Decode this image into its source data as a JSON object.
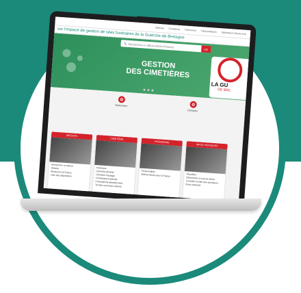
{
  "colors": {
    "teal": "#1b8a7a",
    "red": "#d4232b",
    "green": "#2d8f5c"
  },
  "screen": {
    "nav": [
      "Défunts",
      "Cimetières",
      "Patrimoine",
      "Infos pratiques",
      "Opérateurs (Accès pro)"
    ],
    "tagline": "sur l'espace de gestion de sites funéraires de la Guerche-de-Bretagne",
    "search": {
      "placeholder": "Rechercher un défunt (NOM Prénom)",
      "button": "OK"
    },
    "hero": {
      "title_line1": "GESTION",
      "title_line2": "DES CIMETIÈRES",
      "slides": 3
    },
    "logo": {
      "main": "LA GU",
      "sub": "DE BRE"
    },
    "actions": [
      {
        "label": "Rechercher",
        "icon": "search-icon"
      },
      {
        "label": "Contacter",
        "icon": "mail-icon"
      }
    ],
    "cards": [
      {
        "label": "DÉFUNTS",
        "items": [
          "Rechercher un défunt",
          "Défunts",
          "Morts pour la France",
          "Liste des disparitions"
        ]
      },
      {
        "label": "CIMETIÈRE",
        "items": [
          "Historique",
          "Cimetière Minéral",
          "Cimetière Paysage",
          "Commissions défunts",
          "Concessions abandonnées",
          "Terrains communs expirés"
        ]
      },
      {
        "label": "PATRIMOINE",
        "items": [
          "Personnalités",
          "Défunts Morts pour la France"
        ]
      },
      {
        "label": "INFOS PRATIQUES",
        "items": [
          "Actualités",
          "Démarches en cas de décès",
          "Consulter la liste des opérateurs",
          "Nous contacter"
        ]
      }
    ]
  }
}
